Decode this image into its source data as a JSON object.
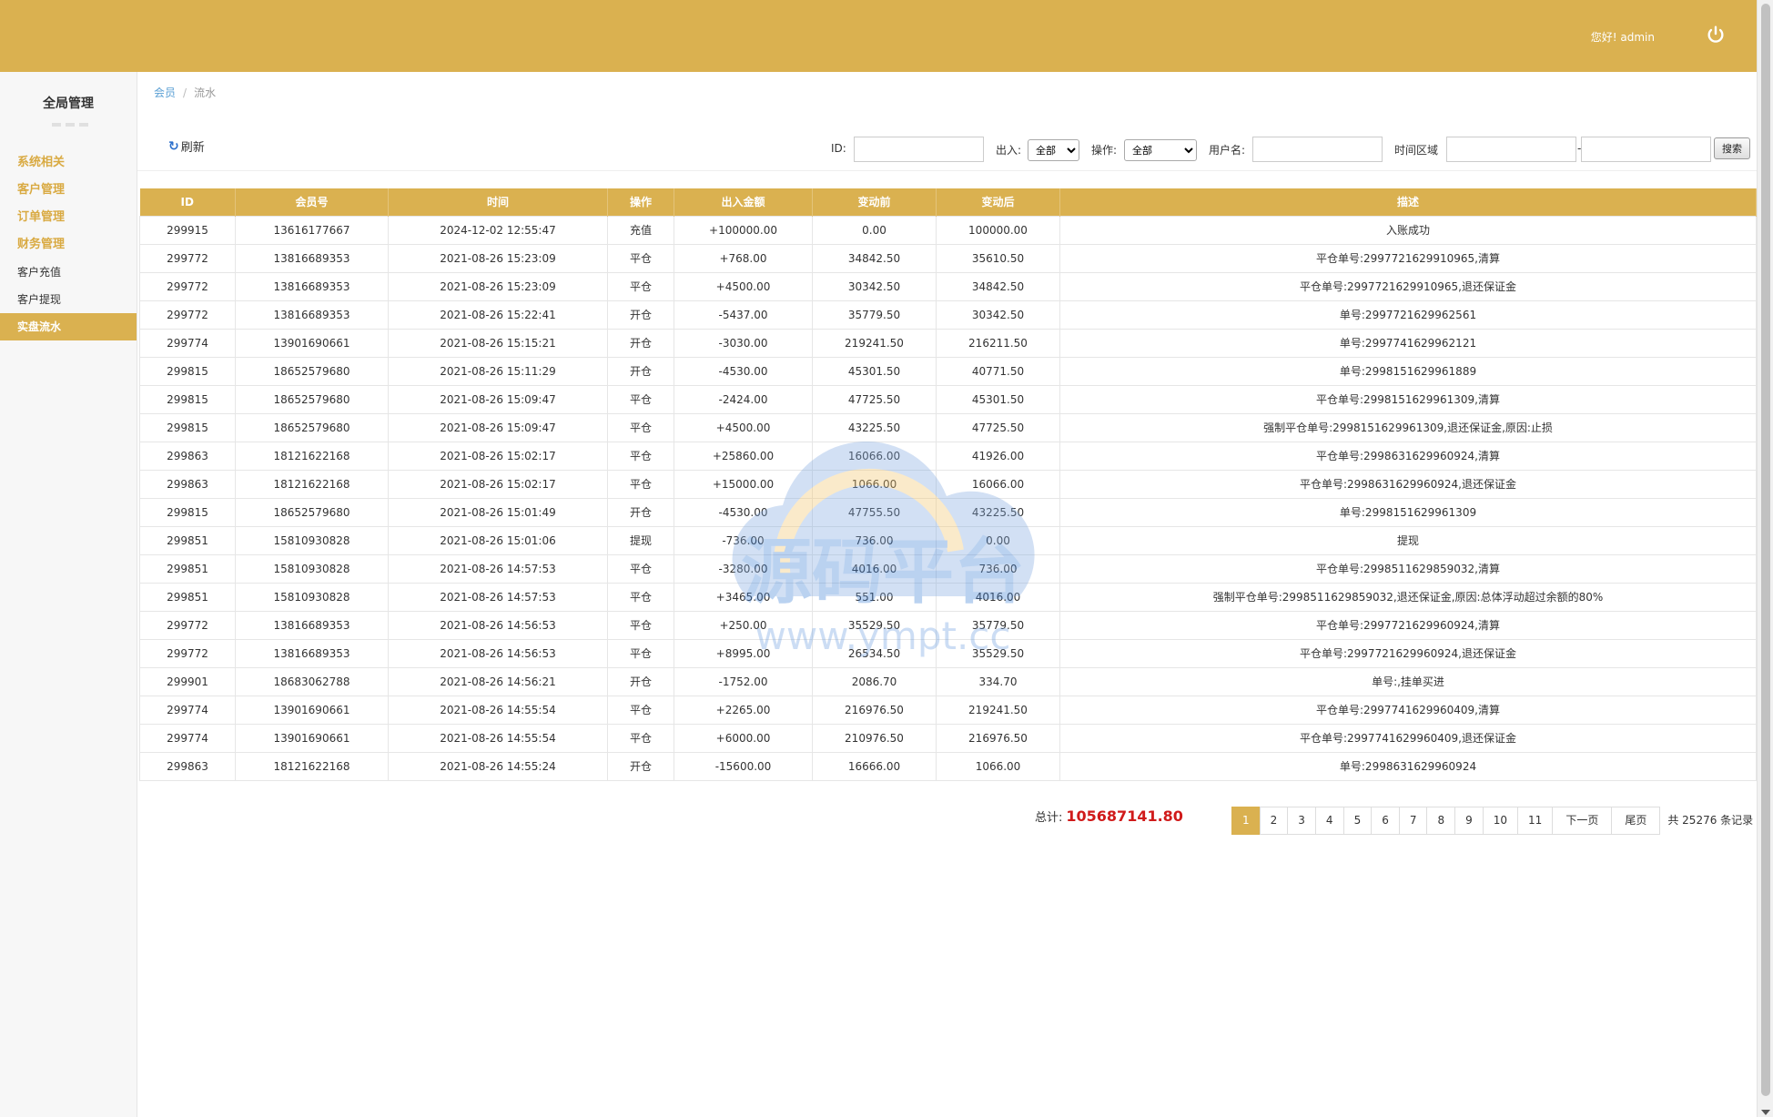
{
  "header": {
    "greeting": "您好! admin",
    "power_icon": "power-icon",
    "bg_color": "#dab150"
  },
  "sidebar": {
    "title": "全局管理",
    "items": [
      {
        "label": "系统相关",
        "kind": "group"
      },
      {
        "label": "客户管理",
        "kind": "group"
      },
      {
        "label": "订单管理",
        "kind": "group"
      },
      {
        "label": "财务管理",
        "kind": "group"
      },
      {
        "label": "客户充值",
        "kind": "sub"
      },
      {
        "label": "客户提现",
        "kind": "sub"
      },
      {
        "label": "实盘流水",
        "kind": "active"
      }
    ]
  },
  "breadcrumb": {
    "parent": "会员",
    "sep": "/",
    "current": "流水"
  },
  "toolbar": {
    "refresh_label": "刷新"
  },
  "filters": {
    "id_label": "ID:",
    "id_value": "",
    "inout_label": "出入:",
    "inout_selected": "全部",
    "op_label": "操作:",
    "op_selected": "全部",
    "username_label": "用户名:",
    "username_value": "",
    "time_label": "时间区域",
    "time_start": "",
    "time_sep": "-",
    "time_end": "",
    "search_label": "搜索"
  },
  "table": {
    "columns": [
      "ID",
      "会员号",
      "时间",
      "操作",
      "出入金额",
      "变动前",
      "变动后",
      "描述"
    ],
    "rows": [
      [
        "299915",
        "13616177667",
        "2024-12-02 12:55:47",
        "充值",
        "+100000.00",
        "0.00",
        "100000.00",
        "入账成功"
      ],
      [
        "299772",
        "13816689353",
        "2021-08-26 15:23:09",
        "平仓",
        "+768.00",
        "34842.50",
        "35610.50",
        "平仓单号:2997721629910965,清算"
      ],
      [
        "299772",
        "13816689353",
        "2021-08-26 15:23:09",
        "平仓",
        "+4500.00",
        "30342.50",
        "34842.50",
        "平仓单号:2997721629910965,退还保证金"
      ],
      [
        "299772",
        "13816689353",
        "2021-08-26 15:22:41",
        "开仓",
        "-5437.00",
        "35779.50",
        "30342.50",
        "单号:2997721629962561"
      ],
      [
        "299774",
        "13901690661",
        "2021-08-26 15:15:21",
        "开仓",
        "-3030.00",
        "219241.50",
        "216211.50",
        "单号:2997741629962121"
      ],
      [
        "299815",
        "18652579680",
        "2021-08-26 15:11:29",
        "开仓",
        "-4530.00",
        "45301.50",
        "40771.50",
        "单号:2998151629961889"
      ],
      [
        "299815",
        "18652579680",
        "2021-08-26 15:09:47",
        "平仓",
        "-2424.00",
        "47725.50",
        "45301.50",
        "平仓单号:2998151629961309,清算"
      ],
      [
        "299815",
        "18652579680",
        "2021-08-26 15:09:47",
        "平仓",
        "+4500.00",
        "43225.50",
        "47725.50",
        "强制平仓单号:2998151629961309,退还保证金,原因:止损"
      ],
      [
        "299863",
        "18121622168",
        "2021-08-26 15:02:17",
        "平仓",
        "+25860.00",
        "16066.00",
        "41926.00",
        "平仓单号:2998631629960924,清算"
      ],
      [
        "299863",
        "18121622168",
        "2021-08-26 15:02:17",
        "平仓",
        "+15000.00",
        "1066.00",
        "16066.00",
        "平仓单号:2998631629960924,退还保证金"
      ],
      [
        "299815",
        "18652579680",
        "2021-08-26 15:01:49",
        "开仓",
        "-4530.00",
        "47755.50",
        "43225.50",
        "单号:2998151629961309"
      ],
      [
        "299851",
        "15810930828",
        "2021-08-26 15:01:06",
        "提现",
        "-736.00",
        "736.00",
        "0.00",
        "提现"
      ],
      [
        "299851",
        "15810930828",
        "2021-08-26 14:57:53",
        "平仓",
        "-3280.00",
        "4016.00",
        "736.00",
        "平仓单号:2998511629859032,清算"
      ],
      [
        "299851",
        "15810930828",
        "2021-08-26 14:57:53",
        "平仓",
        "+3465.00",
        "551.00",
        "4016.00",
        "强制平仓单号:2998511629859032,退还保证金,原因:总体浮动超过余额的80%"
      ],
      [
        "299772",
        "13816689353",
        "2021-08-26 14:56:53",
        "平仓",
        "+250.00",
        "35529.50",
        "35779.50",
        "平仓单号:2997721629960924,清算"
      ],
      [
        "299772",
        "13816689353",
        "2021-08-26 14:56:53",
        "平仓",
        "+8995.00",
        "26534.50",
        "35529.50",
        "平仓单号:2997721629960924,退还保证金"
      ],
      [
        "299901",
        "18683062788",
        "2021-08-26 14:56:21",
        "开仓",
        "-1752.00",
        "2086.70",
        "334.70",
        "单号:,挂单买进"
      ],
      [
        "299774",
        "13901690661",
        "2021-08-26 14:55:54",
        "平仓",
        "+2265.00",
        "216976.50",
        "219241.50",
        "平仓单号:2997741629960409,清算"
      ],
      [
        "299774",
        "13901690661",
        "2021-08-26 14:55:54",
        "平仓",
        "+6000.00",
        "210976.50",
        "216976.50",
        "平仓单号:2997741629960409,退还保证金"
      ],
      [
        "299863",
        "18121622168",
        "2021-08-26 14:55:24",
        "开仓",
        "-15600.00",
        "16666.00",
        "1066.00",
        "单号:2998631629960924"
      ]
    ]
  },
  "summary": {
    "total_label": "总计:",
    "total_value": "105687141.80"
  },
  "pagination": {
    "current": "1",
    "pages": [
      "1",
      "2",
      "3",
      "4",
      "5",
      "6",
      "7",
      "8",
      "9",
      "10",
      "11"
    ],
    "next_label": "下一页",
    "last_label": "尾页",
    "info": "共 25276 条记录"
  },
  "watermark": {
    "text_cn": "源码平台",
    "text_url": "www.ympt.cc"
  }
}
